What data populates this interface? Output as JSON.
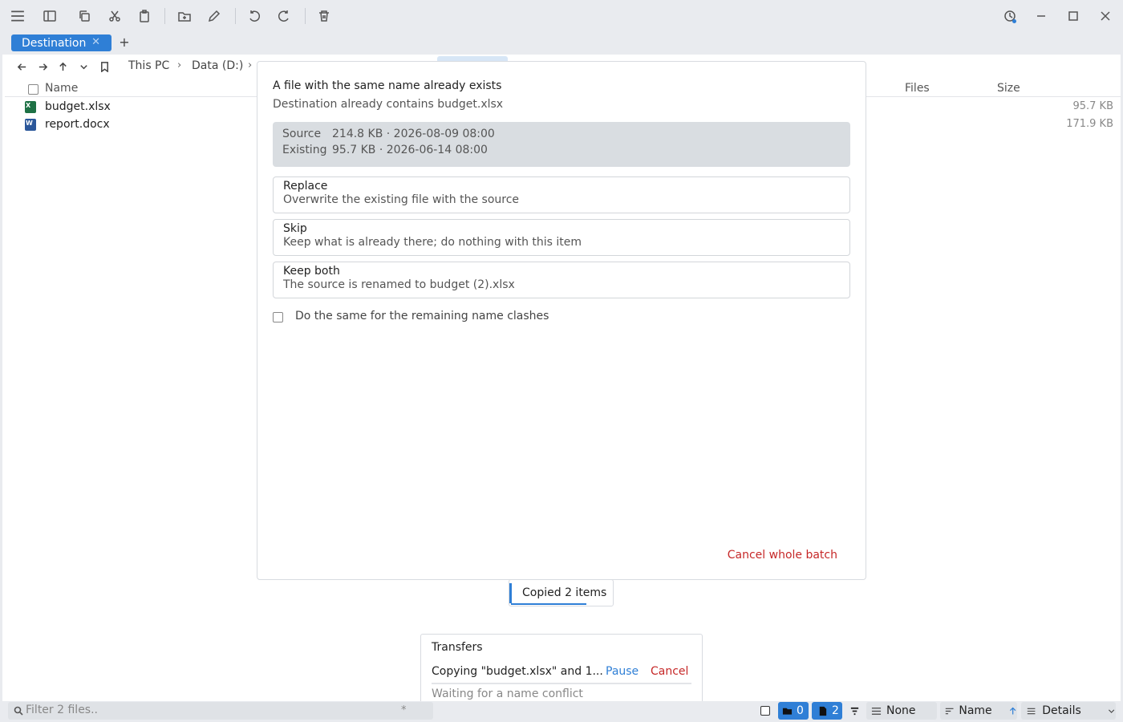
{
  "window": {
    "tab_label": "Destination",
    "tab_close": "✕",
    "new_tab": "+"
  },
  "breadcrumb": [
    "This PC",
    "Data (D:)"
  ],
  "breadcrumb_sep": "›",
  "columns": {
    "name": "Name",
    "files": "Files",
    "size": "Size"
  },
  "files": [
    {
      "name": "budget.xlsx",
      "size": "95.7 KB",
      "icon": "excel-file-icon",
      "color": "#1e7145"
    },
    {
      "name": "report.docx",
      "size": "171.9 KB",
      "icon": "word-file-icon",
      "color": "#2b579a"
    }
  ],
  "dialog": {
    "title": "A file with the same name already exists",
    "subtitle": "Destination already contains budget.xlsx",
    "source_label": "Source",
    "source_value": "214.8 KB · 2026-08-09 08:00",
    "existing_label": "Existing",
    "existing_value": "95.7 KB · 2026-06-14 08:00",
    "options": [
      {
        "title": "Replace",
        "desc": "Overwrite the existing file with the source"
      },
      {
        "title": "Skip",
        "desc": "Keep what is already there; do nothing with this item"
      },
      {
        "title": "Keep both",
        "desc": "The source is renamed to budget (2).xlsx"
      }
    ],
    "same_for_rest": "Do the same for the remaining name clashes",
    "cancel_batch": "Cancel whole batch"
  },
  "toast": {
    "text": "Copied 2 items",
    "progress": 0.73
  },
  "transfers": {
    "title": "Transfers",
    "job": "Copying \"budget.xlsx\" and 1...",
    "pause": "Pause",
    "cancel": "Cancel",
    "status": "Waiting for a name conflict"
  },
  "statusbar": {
    "filter_placeholder": "Filter 2 files..",
    "filter_star": "*",
    "folders_count": "0",
    "files_count": "2",
    "group": "None",
    "sort": "Name",
    "view": "Details"
  },
  "colors": {
    "accent": "#2f7fd6",
    "danger": "#c62828"
  }
}
